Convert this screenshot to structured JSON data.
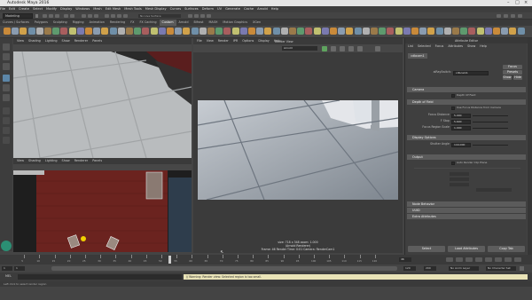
{
  "window": {
    "title": "Autodesk Maya 2016"
  },
  "menubar": [
    "File",
    "Edit",
    "Create",
    "Select",
    "Modify",
    "Display",
    "Windows",
    "Mesh",
    "Edit Mesh",
    "Mesh Tools",
    "Mesh Display",
    "Curves",
    "Surfaces",
    "Deform",
    "UV",
    "Generate",
    "Cache",
    "Arnold",
    "Help"
  ],
  "status": {
    "mode": "Modeling",
    "no_live": "No Live Surface"
  },
  "shelf_tabs": [
    "Curves / Surfaces",
    "Polygons",
    "Sculpting",
    "Rigging",
    "Animation",
    "Rendering",
    "FX",
    "FX Caching",
    "Custom",
    "Arnold",
    "Bifrost",
    "MASH",
    "Motion Graphics",
    "XGen"
  ],
  "shelf_active": "Custom",
  "viewport_menu": [
    "View",
    "Shading",
    "Lighting",
    "Show",
    "Renderer",
    "Panels"
  ],
  "render_view": {
    "menu": [
      "File",
      "View",
      "Render",
      "IPR",
      "Options",
      "Display",
      "Help"
    ],
    "title": "Render View",
    "camera": "Arnold",
    "info": [
      "size: 718 x 348  zoom: 1.000",
      "(Arnold Renderer)",
      "Frame: 46     Render Time: 0:01     Camera: RenderCam1"
    ]
  },
  "attribute_editor": {
    "title": "Attribute Editor",
    "menu": [
      "List",
      "Selected",
      "Focus",
      "Attributes",
      "Show",
      "Help"
    ],
    "tab": "cdbcam1",
    "node_label": "aiRaySwitch:",
    "node_value": "cdbcam1",
    "side_buttons": [
      "Focus",
      "Presets",
      "Show",
      "Hide"
    ],
    "sections": [
      "Camera",
      "Depth of Field",
      "Display Options",
      "Output"
    ],
    "fields": [
      {
        "label": "Focus Distance",
        "value": "5.000"
      },
      {
        "label": "F Stop",
        "value": "5.600"
      },
      {
        "label": "Focus Region Scale",
        "value": "1.000"
      },
      {
        "label": "Shutter Angle",
        "value": "144.000"
      }
    ],
    "checks": [
      "Depth Of Field",
      "Use Focus Distance from Camera",
      "Auto Render Clip Plane"
    ],
    "collapsed": [
      "Node Behavior",
      "UUID",
      "Extra Attributes"
    ],
    "buttons": [
      "Select",
      "Load Attributes",
      "Copy Tab"
    ]
  },
  "timeline": {
    "ticks": [
      "5",
      "10",
      "15",
      "20",
      "25",
      "30",
      "35",
      "40",
      "45",
      "50",
      "55",
      "60",
      "65",
      "70",
      "75",
      "80",
      "85",
      "90",
      "95",
      "100",
      "105",
      "110",
      "115",
      "120"
    ],
    "current": "46",
    "range_start": "1",
    "range_end": "120",
    "anim_end": "200",
    "no_layer": "No Anim Layer",
    "no_char": "No Character Set"
  },
  "command": {
    "lang": "MEL",
    "warning": "// Warning: Render view: Selected region is too small."
  },
  "help": "Left click to select render region"
}
